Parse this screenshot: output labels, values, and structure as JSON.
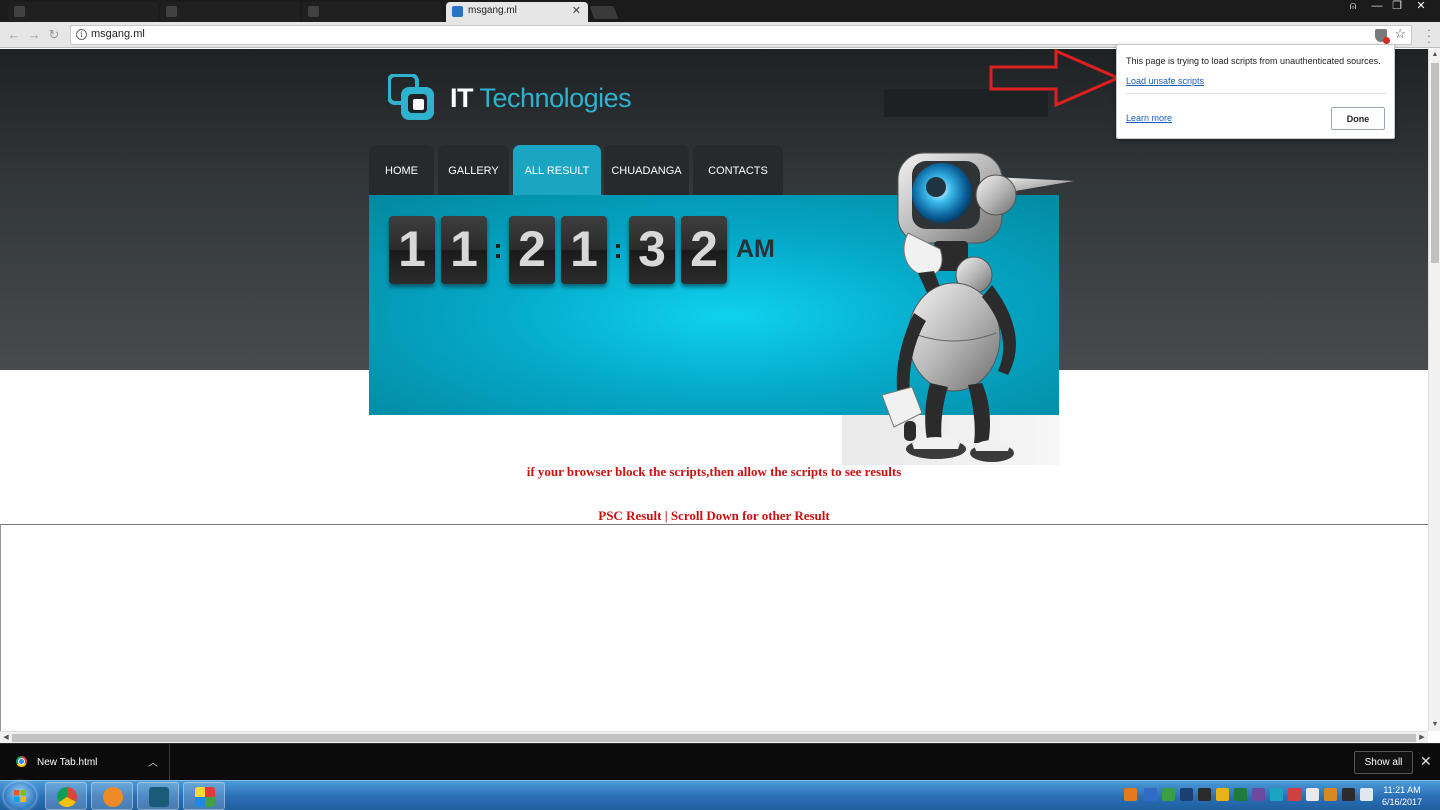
{
  "browser": {
    "tabs": [
      {
        "label": "",
        "state": "blurred"
      },
      {
        "label": "",
        "state": "blurred"
      },
      {
        "label": "",
        "state": "blurred"
      },
      {
        "label": "msgang.ml",
        "state": "active"
      }
    ],
    "url": "msgang.ml"
  },
  "site": {
    "logo": {
      "it": "IT",
      "tech": "Technologies"
    },
    "nav": [
      "HOME",
      "GALLERY",
      "ALL RESULT",
      "CHUADANGA",
      "CONTACTS"
    ],
    "active_nav": "ALL RESULT",
    "clock": {
      "digits": [
        "1",
        "1",
        "2",
        "1",
        "3",
        "2"
      ],
      "ampm": "AM"
    },
    "notice": "if your browser block the scripts,then allow the scripts to see results",
    "result_line": "PSC Result | Scroll Down for other Result"
  },
  "security_bubble": {
    "message": "This page is trying to load scripts from unauthenticated sources.",
    "load_link": "Load unsafe scripts",
    "learn_more": "Learn more",
    "done": "Done"
  },
  "download_bar": {
    "file": "New Tab.html",
    "show_all": "Show all"
  },
  "taskbar": {
    "time": "11:21 AM",
    "date": "6/16/2017"
  },
  "colors": {
    "accent": "#1aa6c2",
    "notice_red": "#cc1111",
    "arrow_red": "#e02020"
  }
}
